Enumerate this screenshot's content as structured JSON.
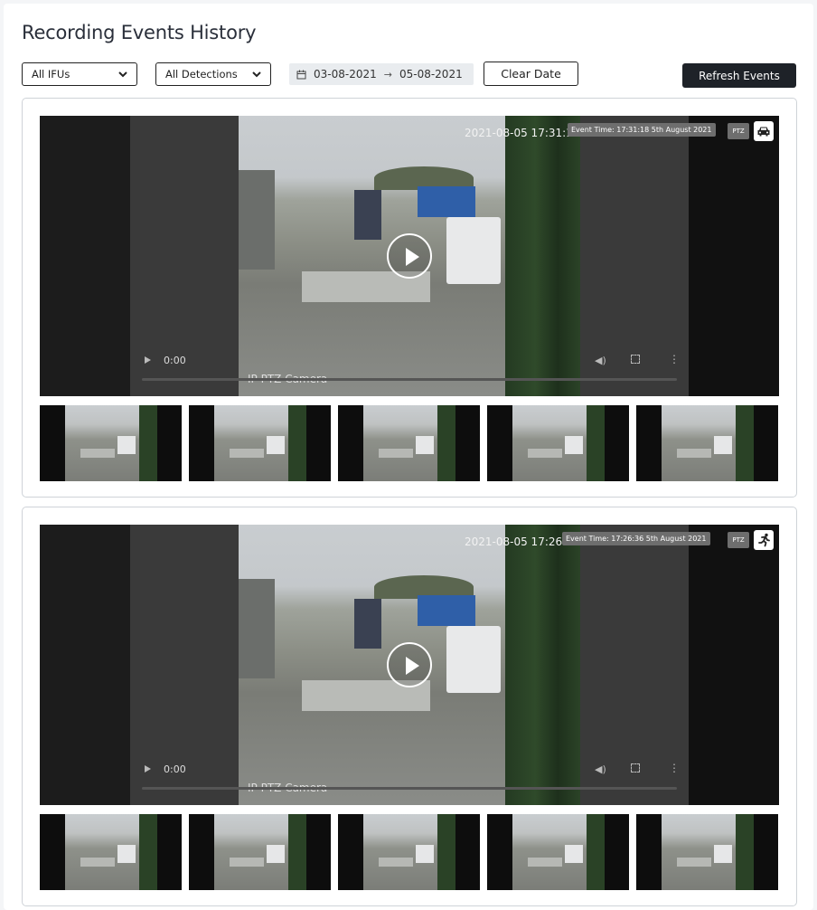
{
  "page": {
    "title": "Recording Events History"
  },
  "filters": {
    "ifu_select": "All IFUs",
    "detection_select": "All Detections",
    "date_from": "03-08-2021",
    "date_to": "05-08-2021",
    "clear_date_label": "Clear Date",
    "refresh_label": "Refresh Events"
  },
  "events": [
    {
      "timestamp_overlay": "2021-08-05 17:31:18",
      "camera_label": "IP PTZ Camera",
      "event_time": "Event Time: 17:31:18 5th August 2021",
      "camera_type": "PTZ",
      "detection_icon": "car-icon",
      "current_time": "0:00"
    },
    {
      "timestamp_overlay": "2021-08-05 17:26:36",
      "camera_label": "IP PTZ Camera",
      "event_time": "Event Time: 17:26:36 5th August 2021",
      "camera_type": "PTZ",
      "detection_icon": "person-running-icon",
      "current_time": "0:00"
    }
  ],
  "colors": {
    "primary_dark": "#1e2228",
    "border": "#cfd3d8",
    "date_bg": "#e9ecef"
  }
}
